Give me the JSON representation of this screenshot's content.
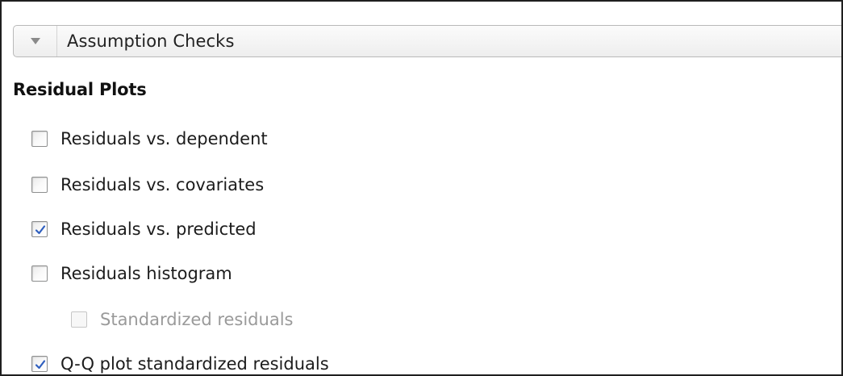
{
  "section": {
    "title": "Assumption Checks",
    "expanded": true,
    "icon": "chevron-down-icon"
  },
  "residual_plots": {
    "title": "Residual Plots",
    "options": [
      {
        "label": "Residuals vs. dependent",
        "checked": false,
        "enabled": true
      },
      {
        "label": "Residuals vs. covariates",
        "checked": false,
        "enabled": true
      },
      {
        "label": "Residuals vs. predicted",
        "checked": true,
        "enabled": true
      },
      {
        "label": "Residuals histogram",
        "checked": false,
        "enabled": true
      },
      {
        "label": "Standardized residuals",
        "checked": false,
        "enabled": false
      },
      {
        "label": "Q-Q plot standardized residuals",
        "checked": true,
        "enabled": true
      }
    ]
  },
  "colors": {
    "checkmark": "#2f5fbf",
    "disabled_text": "#9a9a9a"
  }
}
